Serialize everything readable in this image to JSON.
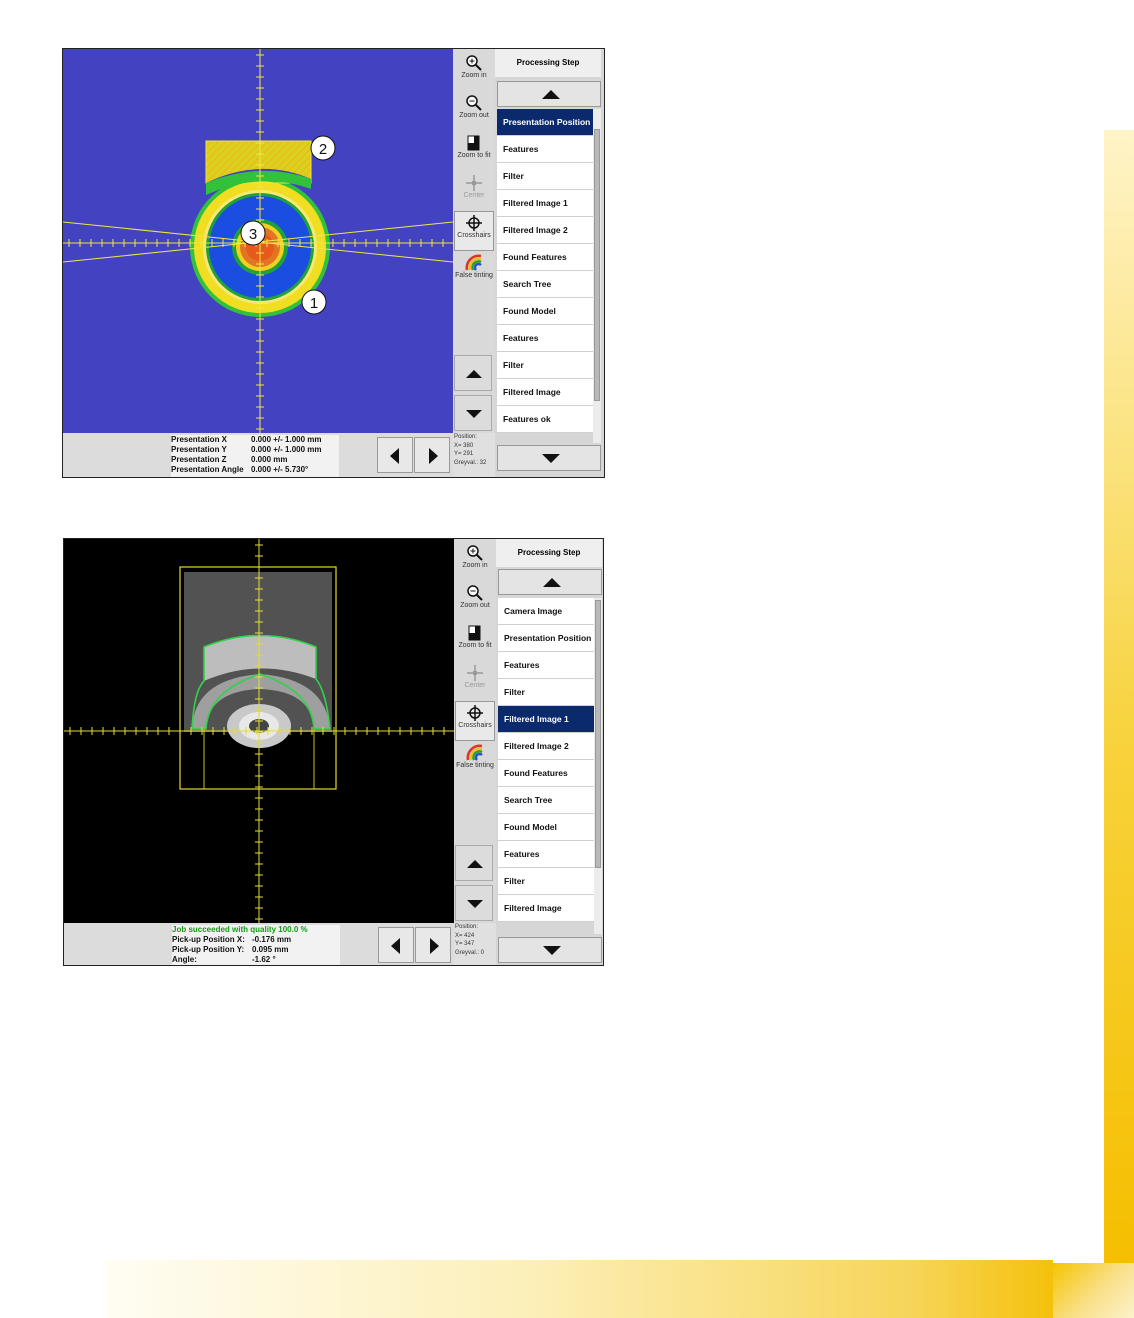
{
  "panel1": {
    "list_title": "Processing Step",
    "list_items": [
      "Presentation Position",
      "Features",
      "Filter",
      "Filtered Image  1",
      "Filtered Image  2",
      "Found Features",
      "Search Tree",
      "Found Model",
      "Features",
      "Filter",
      "Filtered Image",
      "Features ok"
    ],
    "selected_index": 0,
    "tools": {
      "zoom_in": "Zoom in",
      "zoom_out": "Zoom out",
      "zoom_fit": "Zoom to fit",
      "center": "Center",
      "crosshairs": "Crosshairs",
      "false_tinting": "False tinting"
    },
    "status": [
      {
        "k": "Presentation X",
        "v": "0.000 +/- 1.000 mm"
      },
      {
        "k": "Presentation Y",
        "v": "0.000 +/- 1.000 mm"
      },
      {
        "k": "Presentation Z",
        "v": "0.000 mm"
      },
      {
        "k": "Presentation Angle",
        "v": "0.000 +/- 5.730°"
      }
    ],
    "position": {
      "label": "Position:",
      "x": "X= 380",
      "y": "Y= 291",
      "grey": "Greyval.: 32"
    },
    "callouts": [
      "1",
      "2",
      "3"
    ]
  },
  "panel2": {
    "list_title": "Processing Step",
    "list_items": [
      "Camera Image",
      "Presentation Position",
      "Features",
      "Filter",
      "Filtered Image  1",
      "Filtered Image  2",
      "Found Features",
      "Search Tree",
      "Found Model",
      "Features",
      "Filter",
      "Filtered Image"
    ],
    "selected_index": 4,
    "tools": {
      "zoom_in": "Zoom in",
      "zoom_out": "Zoom out",
      "zoom_fit": "Zoom to fit",
      "center": "Center",
      "crosshairs": "Crosshairs",
      "false_tinting": "False tinting"
    },
    "status_header": "Job succeeded with quality  100.0 %",
    "status": [
      {
        "k": "Pick-up Position X:",
        "v": "-0.176 mm"
      },
      {
        "k": "Pick-up Position Y:",
        "v": "0.095 mm"
      },
      {
        "k": "Angle:",
        "v": "-1.62 °"
      }
    ],
    "position": {
      "label": "Position:",
      "x": "X= 424",
      "y": "Y= 347",
      "grey": "Greyval.: 0"
    }
  }
}
